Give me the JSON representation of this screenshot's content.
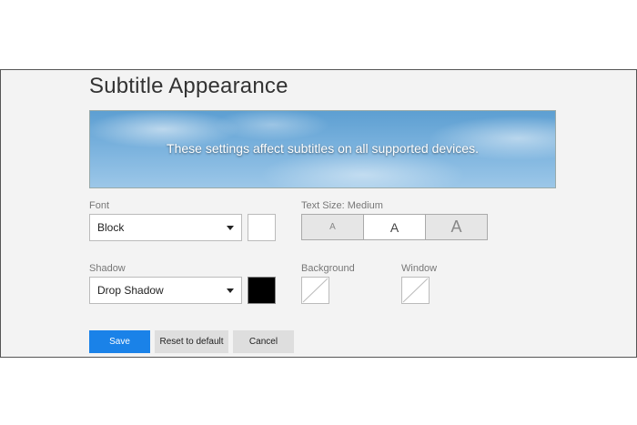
{
  "page": {
    "title": "Subtitle Appearance",
    "banner_text": "These settings affect subtitles on all supported devices."
  },
  "font": {
    "label": "Font",
    "value": "Block",
    "color": "#ffffff"
  },
  "text_size": {
    "label": "Text Size: Medium",
    "options": [
      "A",
      "A",
      "A"
    ],
    "selected": "Medium"
  },
  "shadow": {
    "label": "Shadow",
    "value": "Drop Shadow",
    "color": "#000000"
  },
  "background": {
    "label": "Background"
  },
  "window": {
    "label": "Window"
  },
  "actions": {
    "save": "Save",
    "reset": "Reset to default",
    "cancel": "Cancel"
  },
  "colors": {
    "primary": "#1a82e8",
    "panel": "#f3f3f3"
  }
}
